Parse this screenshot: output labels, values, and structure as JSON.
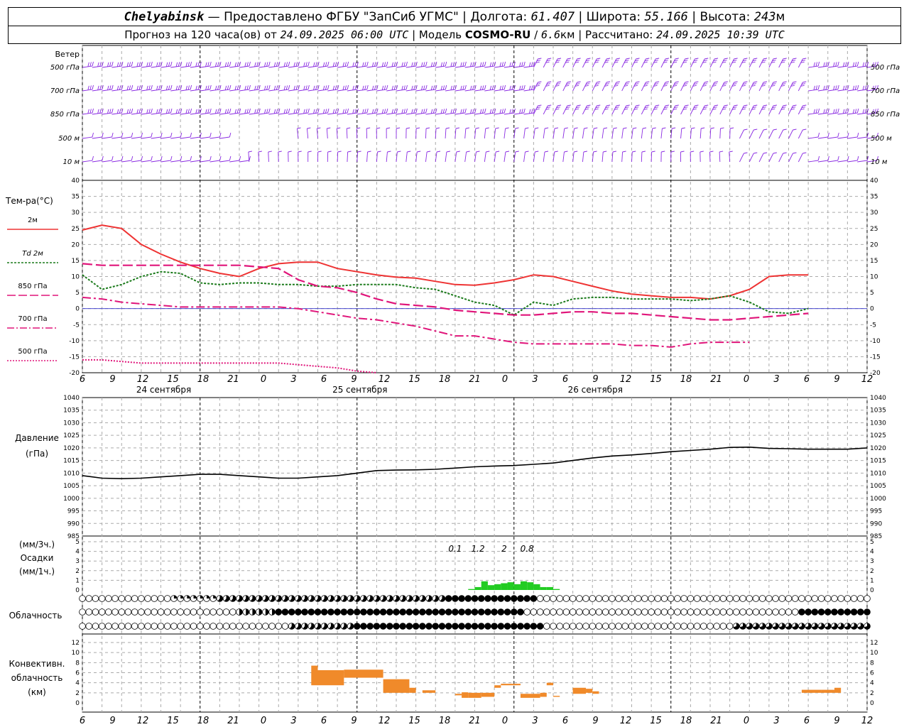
{
  "header": {
    "station": "Chelyabinsk",
    "dash": "—",
    "provider": "Предоставлено ФГБУ \"ЗапСиб УГМС\"",
    "sep": "|",
    "lon_label": "Долгота:",
    "lon_value": "61.407",
    "lat_label": "Широта:",
    "lat_value": "55.166",
    "alt_label": "Высота:",
    "alt_value": "243",
    "alt_unit": "м",
    "forecast_text": "Прогноз на 120 часа(ов) от",
    "forecast_start": "24.09.2025 06:00 UTC",
    "model_label": "Модель",
    "model_name": "COSMO-RU",
    "model_res": "6.6",
    "model_res_unit": "км",
    "calc_label": "Рассчитано:",
    "calc_time": "24.09.2025 10:39 UTC"
  },
  "colors": {
    "wind": "#8a2be2",
    "t2m": "#ee3333",
    "td2m": "#1a7a1a",
    "t850": "#e0157a",
    "t700": "#e0157a",
    "t500": "#e0157a",
    "pressure": "#000000",
    "precip": "#22cc22",
    "convective": "#f08a2a",
    "grid": "#999999"
  },
  "x_axis": {
    "hour_ticks": [
      "6",
      "9",
      "12",
      "15",
      "18",
      "21",
      "0",
      "3",
      "6",
      "9",
      "12",
      "15",
      "18",
      "21",
      "0",
      "3",
      "6",
      "9",
      "12",
      "15",
      "18",
      "21",
      "0",
      "3",
      "6",
      "9",
      "12"
    ],
    "dates": [
      "24 сентября",
      "25 сентября",
      "26 сентября"
    ]
  },
  "wind": {
    "title": "Ветер",
    "levels": [
      "500 гПа",
      "700 гПа",
      "850 гПа",
      "500 м",
      "10 м"
    ]
  },
  "temp_panel": {
    "title": "Тем-ра(°С)",
    "legend": [
      {
        "label": "2м",
        "key": "t2m"
      },
      {
        "label": "Td 2м",
        "key": "td2m"
      },
      {
        "label": "850 гПа",
        "key": "t850"
      },
      {
        "label": "700 гПа",
        "key": "t700"
      },
      {
        "label": "500 гПа",
        "key": "t500"
      }
    ],
    "ticks": [
      "40",
      "35",
      "30",
      "25",
      "20",
      "15",
      "10",
      "5",
      "0",
      "-5",
      "-10",
      "-15",
      "-20"
    ]
  },
  "pressure_panel": {
    "title_1": "Давление",
    "title_2": "(гПа)",
    "ticks": [
      "1040",
      "1035",
      "1030",
      "1025",
      "1020",
      "1015",
      "1010",
      "1005",
      "1000",
      "995",
      "990",
      "985"
    ]
  },
  "precip_panel": {
    "title_1": "(мм/3ч.)",
    "title_2": "Осадки",
    "title_3": "(мм/1ч.)",
    "ticks": [
      "5",
      "4",
      "3",
      "2",
      "1",
      "0"
    ],
    "totals": [
      "0.1",
      "1.2",
      "2",
      "0.8"
    ]
  },
  "cloud_panel": {
    "title": "Облачность"
  },
  "conv_panel": {
    "title_1": "Конвективн.",
    "title_2": "облачность",
    "title_3": "(км)",
    "ticks": [
      "12",
      "10",
      "8",
      "6",
      "4",
      "2",
      "0"
    ]
  },
  "chart_data": [
    {
      "type": "line",
      "title": "Тем-ра(°С)",
      "x_hours": [
        0,
        3,
        6,
        9,
        12,
        15,
        18,
        21,
        24,
        27,
        30,
        33,
        36,
        39,
        42,
        45,
        48,
        51,
        54,
        57,
        60,
        63,
        66,
        69,
        72,
        75,
        78,
        81,
        84,
        87,
        90,
        93,
        96,
        99,
        102,
        105,
        108,
        111,
        114,
        117,
        120
      ],
      "ylim": [
        -20,
        40
      ],
      "series": [
        {
          "name": "2м",
          "values": [
            24.5,
            26,
            25,
            20,
            17,
            14.5,
            12.5,
            11,
            10,
            12.5,
            14,
            14.5,
            14.5,
            12.5,
            11.5,
            10.5,
            9.8,
            9.5,
            8.5,
            7.5,
            7.3,
            8,
            9,
            10.5,
            10,
            8.5,
            7,
            5.5,
            4.5,
            4,
            3.5,
            3.5,
            3,
            4,
            6,
            10,
            10.5,
            10.5
          ]
        },
        {
          "name": "Td 2м",
          "values": [
            10.5,
            6,
            7.5,
            10,
            11.5,
            11,
            8,
            7.5,
            8,
            8,
            7.5,
            7.5,
            7,
            7,
            7.5,
            7.5,
            7.5,
            6.5,
            6,
            4,
            2,
            1,
            -2,
            2,
            1,
            3,
            3.5,
            3.5,
            3,
            3,
            3,
            2.5,
            3,
            4,
            2,
            -1,
            -1.5,
            0
          ]
        },
        {
          "name": "850 гПа",
          "values": [
            14,
            13.5,
            13.5,
            13.5,
            13.5,
            13.5,
            13.5,
            13.5,
            13.5,
            13,
            12.5,
            9,
            7,
            6.5,
            5,
            3,
            1.5,
            1,
            0.5,
            -0.5,
            -1,
            -1.5,
            -2,
            -2,
            -1.5,
            -1,
            -1,
            -1.5,
            -1.5,
            -2,
            -2.5,
            -3,
            -3.5,
            -3.5,
            -3,
            -2.5,
            -2,
            -1.5
          ]
        },
        {
          "name": "700 гПа",
          "values": [
            3.5,
            3,
            2,
            1.5,
            1,
            0.5,
            0.5,
            0.5,
            0.5,
            0.5,
            0.5,
            0,
            -1,
            -2,
            -3,
            -3.5,
            -4.5,
            -5.5,
            -7,
            -8.5,
            -8.5,
            -9.5,
            -10.5,
            -11,
            -11,
            -11,
            -11,
            -11,
            -11.5,
            -11.5,
            -12,
            -11,
            -10.5,
            -10.5,
            -10.5
          ]
        },
        {
          "name": "500 гПа",
          "values": [
            -16,
            -16,
            -16.5,
            -17,
            -17,
            -17,
            -17,
            -17,
            -17,
            -17,
            -17,
            -17.5,
            -18,
            -18.5,
            -19.5,
            -20
          ]
        }
      ]
    },
    {
      "type": "line",
      "title": "Давление (гПа)",
      "x_hours": [
        0,
        3,
        6,
        9,
        12,
        15,
        18,
        21,
        24,
        27,
        30,
        33,
        36,
        39,
        42,
        45,
        48,
        51,
        54,
        57,
        60,
        63,
        66,
        69,
        72,
        75,
        78,
        81,
        84,
        87,
        90,
        93,
        96,
        99,
        102,
        105,
        108,
        111,
        114,
        117,
        120
      ],
      "ylim": [
        985,
        1040
      ],
      "values": [
        1009,
        1008,
        1007.8,
        1008,
        1008.5,
        1009,
        1009.5,
        1009.5,
        1009,
        1008.5,
        1008,
        1008,
        1008.5,
        1009,
        1010,
        1011,
        1011.2,
        1011.3,
        1011.5,
        1012,
        1012.5,
        1012.8,
        1013,
        1013.5,
        1014,
        1015,
        1016,
        1016.8,
        1017.2,
        1017.8,
        1018.5,
        1019,
        1019.5,
        1020.2,
        1020.3,
        1019.8,
        1019.7,
        1019.5,
        1019.5,
        1019.5,
        1020
      ]
    },
    {
      "type": "bar",
      "title": "Осадки (мм/1ч.)",
      "x_hours": [
        59,
        60,
        61,
        62,
        63,
        64,
        65,
        66,
        67,
        68,
        69,
        70,
        71,
        72
      ],
      "ylim": [
        0,
        5
      ],
      "values": [
        0.1,
        0.3,
        0.9,
        0.5,
        0.6,
        0.7,
        0.8,
        0.6,
        0.9,
        0.8,
        0.6,
        0.3,
        0.3,
        0.1
      ]
    },
    {
      "type": "bar",
      "title": "Конвективн. облачность (км)",
      "ylim": [
        0,
        13
      ],
      "bars": [
        {
          "x": [
            35,
            36
          ],
          "base": 3.5,
          "top": 7.4
        },
        {
          "x": [
            36,
            40
          ],
          "base": 3.5,
          "top": 6.5
        },
        {
          "x": [
            40,
            46
          ],
          "base": 5,
          "top": 6.6
        },
        {
          "x": [
            46,
            50
          ],
          "base": 2,
          "top": 4.7
        },
        {
          "x": [
            50,
            51
          ],
          "base": 2,
          "top": 3
        },
        {
          "x": [
            52,
            53
          ],
          "base": 2,
          "top": 2.5
        },
        {
          "x": [
            53,
            54
          ],
          "base": 2,
          "top": 2.5
        },
        {
          "x": [
            57,
            58
          ],
          "base": 1.5,
          "top": 1.8
        },
        {
          "x": [
            58,
            59
          ],
          "base": 1,
          "top": 2.1
        },
        {
          "x": [
            59,
            61
          ],
          "base": 1,
          "top": 2
        },
        {
          "x": [
            61,
            63
          ],
          "base": 1.2,
          "top": 2
        },
        {
          "x": [
            63,
            64
          ],
          "base": 3,
          "top": 3.5
        },
        {
          "x": [
            64,
            67
          ],
          "base": 3.5,
          "top": 3.8
        },
        {
          "x": [
            67,
            70
          ],
          "base": 1,
          "top": 1.8
        },
        {
          "x": [
            70,
            71
          ],
          "base": 1.2,
          "top": 2
        },
        {
          "x": [
            71,
            72
          ],
          "base": 3.5,
          "top": 4
        },
        {
          "x": [
            72,
            73
          ],
          "base": 1.2,
          "top": 1.4
        },
        {
          "x": [
            75,
            77
          ],
          "base": 1.8,
          "top": 3
        },
        {
          "x": [
            77,
            78
          ],
          "base": 2,
          "top": 2.8
        },
        {
          "x": [
            78,
            79
          ],
          "base": 1.8,
          "top": 2.3
        },
        {
          "x": [
            110,
            113
          ],
          "base": 2,
          "top": 2.6
        },
        {
          "x": [
            113,
            115
          ],
          "base": 2,
          "top": 2.6
        },
        {
          "x": [
            115,
            116
          ],
          "base": 2,
          "top": 3
        }
      ]
    }
  ]
}
